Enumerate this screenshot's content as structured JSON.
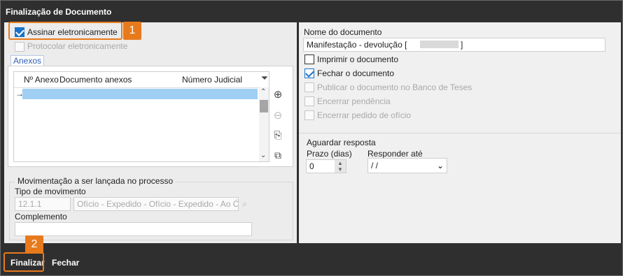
{
  "window": {
    "title": "Finalização de Documento"
  },
  "left": {
    "assinar": {
      "label": "Assinar eletronicamente",
      "checked": true
    },
    "protocolar": {
      "label": "Protocolar eletronicamente",
      "checked": false,
      "disabled": true
    },
    "annex_tab": "Anexos",
    "grid": {
      "columns": [
        "Nº Anexo",
        "Documento anexos",
        "Número Judicial"
      ],
      "rows": [
        {
          "indicator": "→",
          "selected": true
        }
      ]
    },
    "annex_actions": [
      "add-icon",
      "remove-icon",
      "attach-icon",
      "copy-icon"
    ],
    "movement": {
      "legend": "Movimentação a ser lançada no processo",
      "tipo_label": "Tipo de movimento",
      "tipo_code": "12.1.1",
      "tipo_desc": "Ofício - Expedido - Ofício - Expedido - Ao Órg",
      "complemento_label": "Complemento",
      "complemento_value": ""
    }
  },
  "right": {
    "nome_label": "Nome do documento",
    "nome_value": "Manifestação - devolução [",
    "nome_suffix": "]",
    "options": [
      {
        "label": "Imprimir o documento",
        "checked": false,
        "disabled": false
      },
      {
        "label": "Fechar o documento",
        "checked": true,
        "disabled": false
      },
      {
        "label": "Publicar o documento no Banco de Teses",
        "checked": false,
        "disabled": true
      },
      {
        "label": "Encerrar pendência",
        "checked": false,
        "disabled": true
      },
      {
        "label": "Encerrar pedido de ofício",
        "checked": false,
        "disabled": true
      }
    ],
    "aguardar": {
      "legend": "Aguardar resposta",
      "prazo_label": "Prazo (dias)",
      "prazo_value": "0",
      "responder_label": "Responder até",
      "responder_value": " /  /"
    }
  },
  "footer": {
    "finalizar_label": "Finalizar",
    "fechar_label": "Fechar"
  },
  "callouts": {
    "one": "1",
    "two": "2"
  },
  "colors": {
    "accent": "#e77a1c",
    "check": "#1a73c8",
    "dark": "#2f2f2f"
  }
}
